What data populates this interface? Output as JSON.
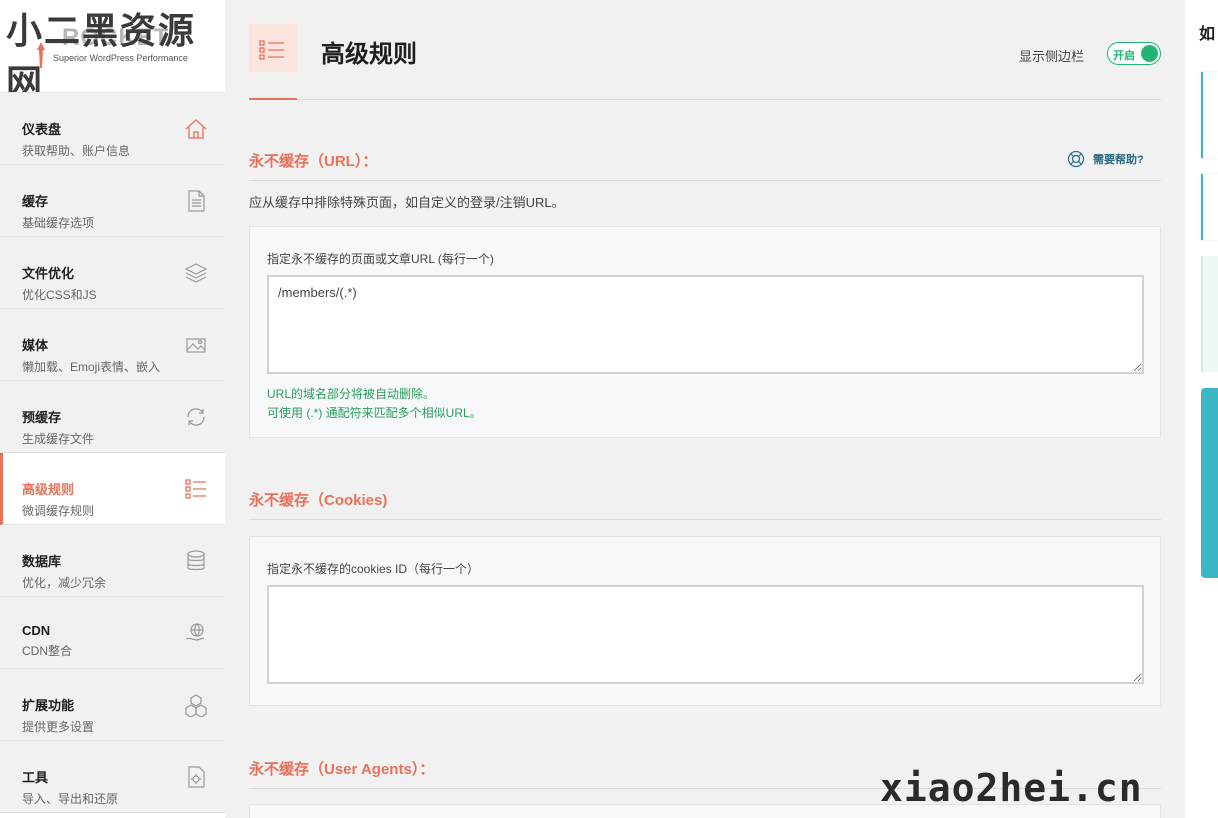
{
  "watermark": {
    "top": "小二黑资源网",
    "bottom": "xiao2hei.cn"
  },
  "logo": {
    "brand": "ROCKET",
    "tagline": "Superior WordPress Performance"
  },
  "sidebar": {
    "items": [
      {
        "title": "仪表盘",
        "subtitle": "获取帮助、账户信息",
        "icon": "home-icon"
      },
      {
        "title": "缓存",
        "subtitle": "基础缓存选项",
        "icon": "document-icon"
      },
      {
        "title": "文件优化",
        "subtitle": "优化CSS和JS",
        "icon": "layers-icon"
      },
      {
        "title": "媒体",
        "subtitle": "懒加载、Emoji表情、嵌入",
        "icon": "image-icon"
      },
      {
        "title": "预缓存",
        "subtitle": "生成缓存文件",
        "icon": "refresh-icon"
      },
      {
        "title": "高级规则",
        "subtitle": "微调缓存规则",
        "icon": "list-icon"
      },
      {
        "title": "数据库",
        "subtitle": "优化，减少冗余",
        "icon": "database-icon"
      },
      {
        "title": "CDN",
        "subtitle": "CDN整合",
        "icon": "globe-hand-icon"
      },
      {
        "title": "扩展功能",
        "subtitle": "提供更多设置",
        "icon": "cubes-icon"
      },
      {
        "title": "工具",
        "subtitle": "导入、导出和还原",
        "icon": "tools-icon"
      }
    ]
  },
  "header": {
    "title": "高级规则",
    "sidebar_toggle_label": "显示侧边栏",
    "sidebar_toggle_state": "开启"
  },
  "sections": {
    "urls": {
      "title": "永不缓存（URL）：",
      "help_label": "需要帮助?",
      "description": "应从缓存中排除特殊页面，如自定义的登录/注销URL。",
      "field_label": "指定永不缓存的页面或文章URL (每行一个)",
      "field_value": "/members/(.*)",
      "hint_1": "URL的域名部分将被自动删除。",
      "hint_2": "可使用 (.*) 通配符来匹配多个相似URL。"
    },
    "cookies": {
      "title": "永不缓存（Cookies)",
      "field_label": "指定永不缓存的cookies ID（每行一个）",
      "field_value": ""
    },
    "user_agents": {
      "title": "永不缓存（User Agents）："
    }
  },
  "right_rail": {
    "title": "如"
  },
  "colors": {
    "accent": "#e8715a",
    "toggle": "#22b574",
    "hint": "#2a9d5c",
    "rail": "#3bb6c4"
  }
}
